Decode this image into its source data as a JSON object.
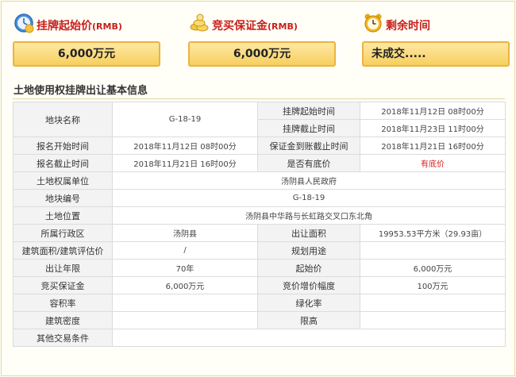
{
  "cards": {
    "start_price": {
      "title": "挂牌起始价",
      "unit": "(RMB)",
      "value": "6,000万元",
      "icon": "clock-money-icon"
    },
    "deposit": {
      "title": "竞买保证金",
      "unit": "(RMB)",
      "value": "6,000万元",
      "icon": "gold-coins-icon"
    },
    "remaining": {
      "title": "剩余时间",
      "value": "未成交.....",
      "icon": "alarm-clock-icon"
    }
  },
  "section_title": "土地使用权挂牌出让基本信息",
  "table": {
    "parcel_name_label": "地块名称",
    "parcel_name_value": "G-18-19",
    "listing_start_label": "挂牌起始时间",
    "listing_start_value": "2018年11月12日 08时00分",
    "listing_end_label": "挂牌截止时间",
    "listing_end_value": "2018年11月23日 11时00分",
    "signup_start_label": "报名开始时间",
    "signup_start_value": "2018年11月12日 08时00分",
    "deposit_deadline_label": "保证金到账截止时间",
    "deposit_deadline_value": "2018年11月21日 16时00分",
    "signup_end_label": "报名截止时间",
    "signup_end_value": "2018年11月21日 16时00分",
    "reserve_label": "是否有底价",
    "reserve_value": "有底价",
    "owner_label": "土地权属单位",
    "owner_value": "汤阴县人民政府",
    "number_label": "地块编号",
    "number_value": "G-18-19",
    "location_label": "土地位置",
    "location_value": "汤阴县中华路与长虹路交叉口东北角",
    "district_label": "所属行政区",
    "district_value": "汤阴县",
    "area_label": "出让面积",
    "area_value": "19953.53平方米（29.93亩）",
    "build_area_label": "建筑面积/建筑评估价",
    "build_area_value": "/",
    "plan_use_label": "规划用途",
    "plan_use_value": "",
    "years_label": "出让年限",
    "years_value": "70年",
    "start_price_label": "起始价",
    "start_price_value": "6,000万元",
    "bid_deposit_label": "竞买保证金",
    "bid_deposit_value": "6,000万元",
    "increment_label": "竞价增价幅度",
    "increment_value": "100万元",
    "far_label": "容积率",
    "far_value": "",
    "green_label": "绿化率",
    "green_value": "",
    "density_label": "建筑密度",
    "density_value": "",
    "height_label": "限高",
    "height_value": "",
    "other_label": "其他交易条件",
    "other_value": ""
  }
}
